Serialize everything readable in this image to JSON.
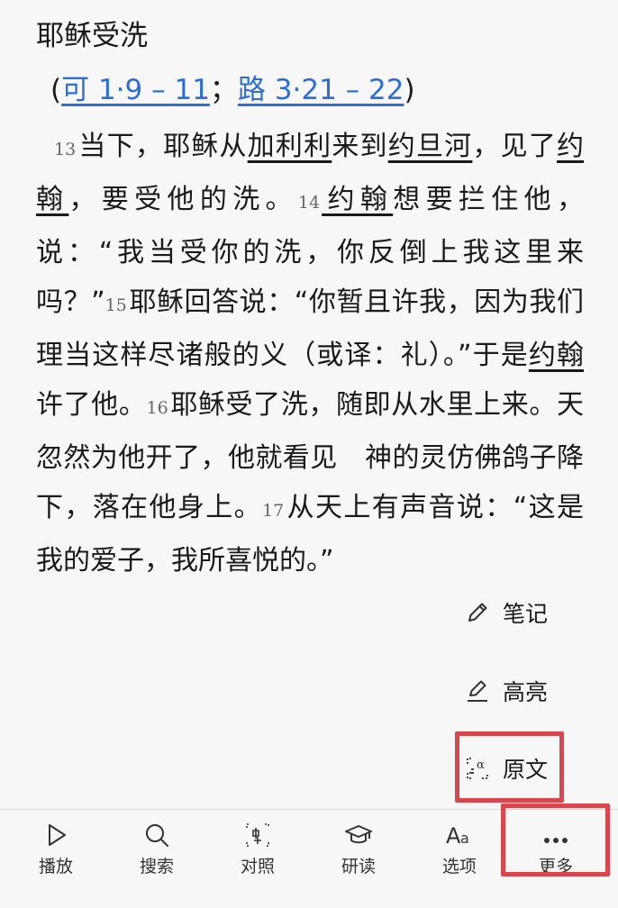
{
  "passage": {
    "heading": "耶稣受洗",
    "refs": {
      "open": "(",
      "ref1": "可 1·9 – 11",
      "sep": "；",
      "ref2": "路 3·21 – 22",
      "close": ")"
    },
    "segments": {
      "v13": "13",
      "t1": "当下，耶稣从",
      "p1": "加利利",
      "t2": "来到",
      "p2": "约旦河",
      "t3": "，见了",
      "p3": "约翰",
      "t4": "，要受他的洗。",
      "v14": "14",
      "p4": "约翰",
      "t5": "想要拦住他，说：“我当受你的洗，你反倒上我这里来吗？”",
      "v15": "15",
      "t6": "耶稣回答说：“你暂且许我，因为我们理当这样尽诸般的义（或译：礼）。”于是",
      "p5": "约翰",
      "t7": "许了他。",
      "v16": "16",
      "t8": "耶稣受了洗，随即从水里上来。天忽然为他开了，他就看见　神的灵仿佛鸽子降下，落在他身上。",
      "v17": "17",
      "t9": "从天上有声音说：“这是我的爱子，我所喜悦的。”"
    }
  },
  "actions": {
    "note": {
      "label": "笔记",
      "icon": "pencil-icon"
    },
    "highlight": {
      "label": "高亮",
      "icon": "highlighter-icon"
    },
    "original": {
      "label": "原文",
      "icon": "original-text-icon"
    }
  },
  "tabbar": {
    "play": {
      "label": "播放",
      "icon": "play-icon"
    },
    "search": {
      "label": "搜索",
      "icon": "search-icon"
    },
    "compare": {
      "label": "对照",
      "icon": "compare-icon"
    },
    "study": {
      "label": "研读",
      "icon": "graduation-cap-icon"
    },
    "options": {
      "label": "选项",
      "icon": "text-size-icon"
    },
    "more": {
      "label": "更多",
      "icon": "more-dots-icon"
    }
  },
  "colors": {
    "link": "#2a6fd6",
    "highlight_box": "#d9464c",
    "background": "#f7f7f7"
  }
}
